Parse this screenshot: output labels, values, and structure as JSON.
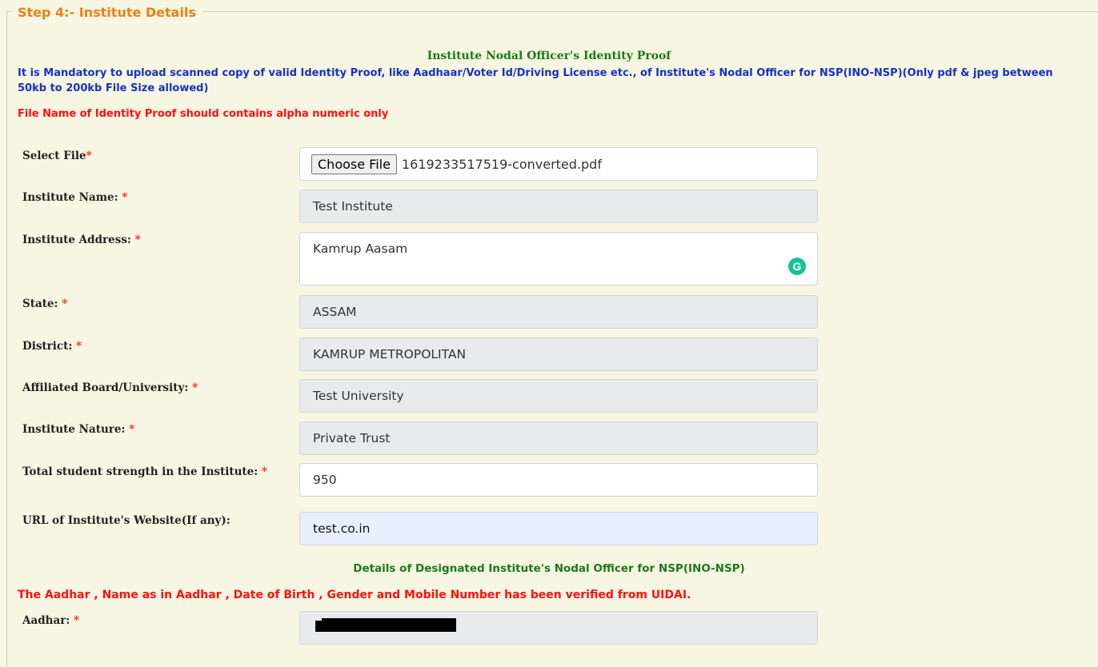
{
  "section": {
    "legend": "Step 4:- Institute Details"
  },
  "identity_proof": {
    "title": "Institute Nodal Officer's Identity Proof",
    "mandatory_note": "It is Mandatory to upload scanned copy of valid Identity Proof, like Aadhaar/Voter Id/Driving License etc., of Institute's Nodal Officer for NSP(INO-NSP)(Only pdf & jpeg between 50kb to 200kb File Size allowed)",
    "filename_note": "File Name of Identity Proof should contains alpha numeric only"
  },
  "fields": {
    "select_file": {
      "label": "Select File",
      "button": "Choose File",
      "value": "1619233517519-converted.pdf"
    },
    "institute_name": {
      "label": "Institute Name: ",
      "value": "Test Institute"
    },
    "institute_address": {
      "label": "Institute Address: ",
      "value": "Kamrup Aasam",
      "grammarly_icon": "G"
    },
    "state": {
      "label": "State: ",
      "value": "ASSAM"
    },
    "district": {
      "label": "District: ",
      "value": "KAMRUP METROPOLITAN"
    },
    "affiliated": {
      "label": "Affiliated Board/University: ",
      "value": "Test University"
    },
    "nature": {
      "label": "Institute Nature: ",
      "value": "Private Trust"
    },
    "strength": {
      "label": "Total student strength in the Institute: ",
      "value": "950"
    },
    "website": {
      "label": "URL of Institute's Website(If any):",
      "value": "test.co.in"
    },
    "aadhar": {
      "label": "Aadhar: ",
      "value": ""
    }
  },
  "required_marker": "*",
  "nodal_officer": {
    "title": "Details of Designated Institute's Nodal Officer for NSP(INO-NSP)",
    "verified_note": "The Aadhar , Name as in Aadhar , Date of Birth , Gender and Mobile Number has been verified from UIDAI."
  },
  "colors": {
    "background": "#f7f6e2",
    "legend": "#f07d14",
    "title_green": "#1a7a1a",
    "note_blue": "#1432c8",
    "note_red": "#ff1010",
    "readonly_field": "#e8eaec",
    "autofill_field": "#e8f0fe"
  }
}
